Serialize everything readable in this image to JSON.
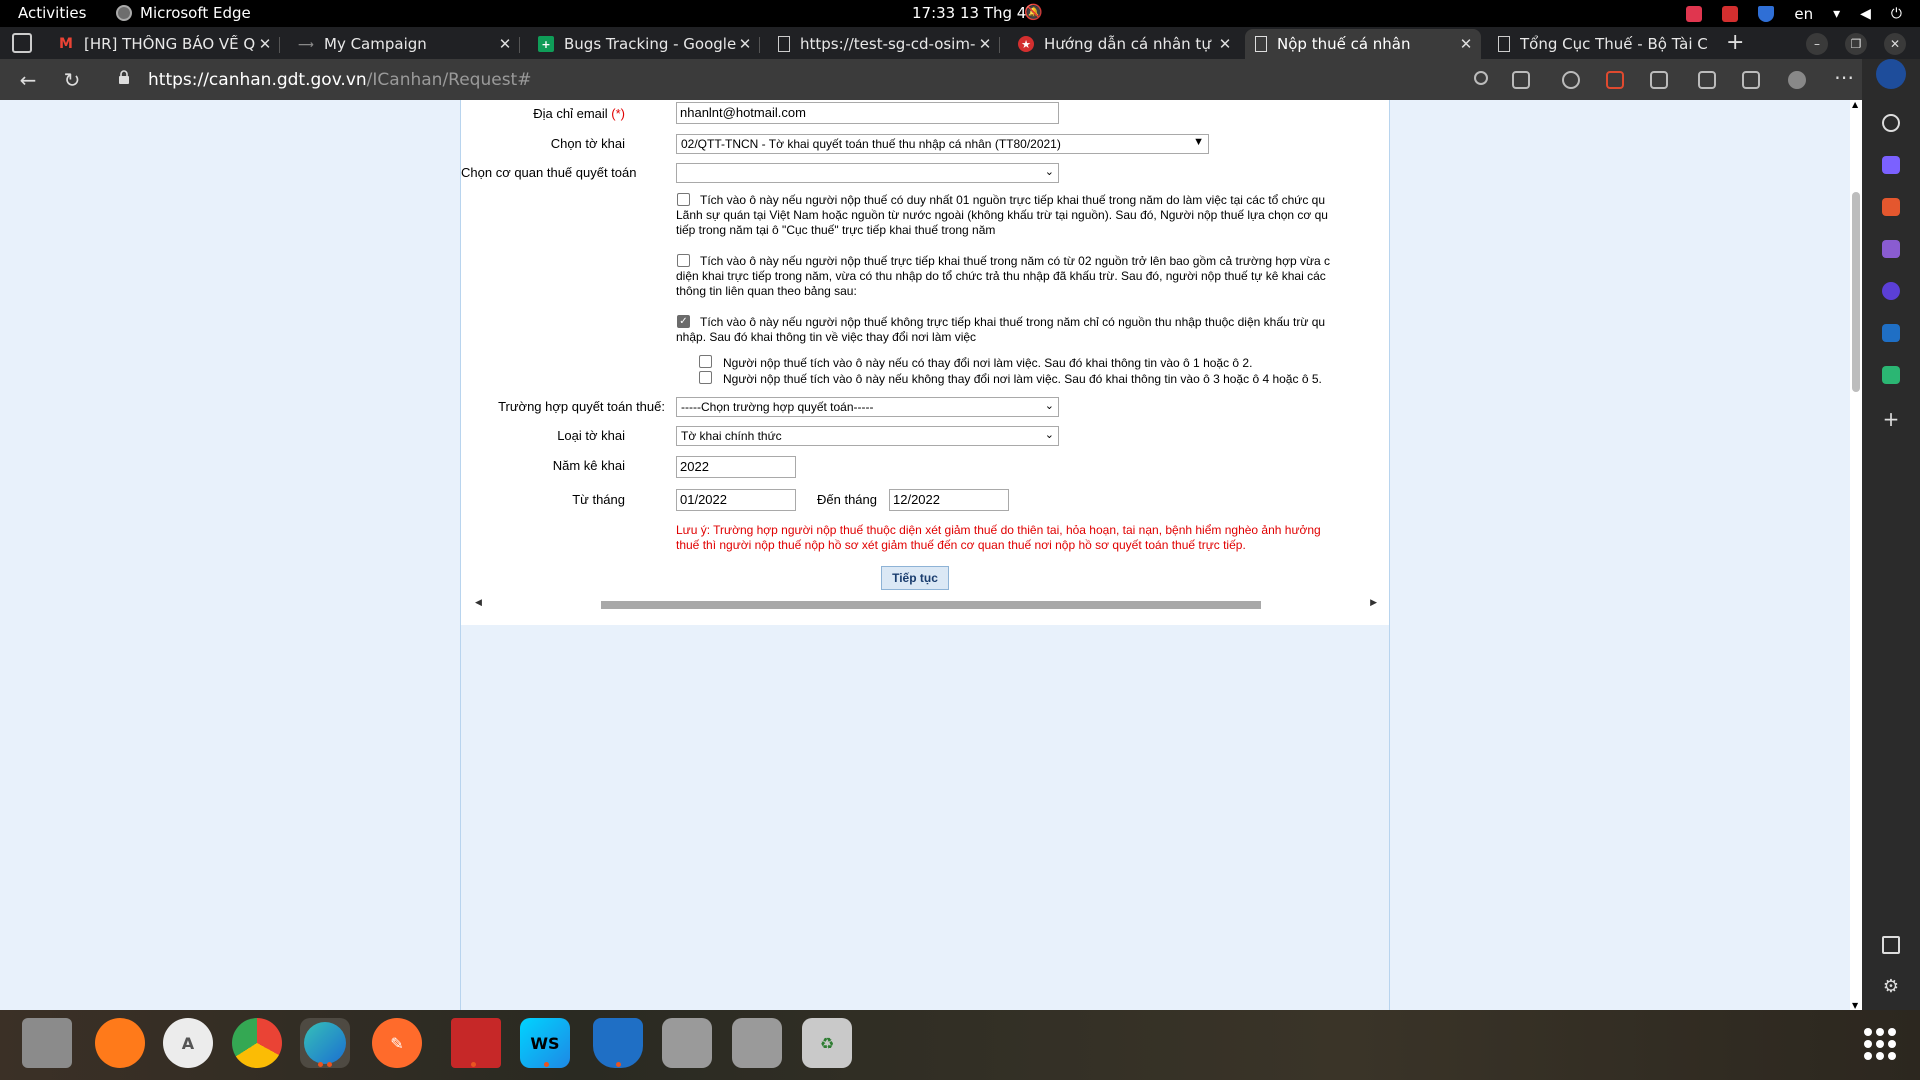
{
  "system_bar": {
    "activities": "Activities",
    "app_name": "Microsoft Edge",
    "clock": "17:33  13 Thg 4",
    "language": "en"
  },
  "tabs": [
    {
      "title": "[HR] THÔNG BÁO VỀ QUY",
      "favicon": "gmail-icon",
      "active": false
    },
    {
      "title": "My Campaign",
      "favicon": "campaign-icon",
      "active": false
    },
    {
      "title": "Bugs Tracking - Google Sh",
      "favicon": "sheets-icon",
      "active": false
    },
    {
      "title": "https://test-sg-cd-osim-n",
      "favicon": "page-icon",
      "active": false
    },
    {
      "title": "Hướng dẫn cá nhân tự q",
      "favicon": "vn-tax-icon",
      "active": false
    },
    {
      "title": "Nộp thuế cá nhân",
      "favicon": "page-icon",
      "active": true
    },
    {
      "title": "Tổng Cục Thuế - Bộ Tài C",
      "favicon": "page-icon",
      "active": false
    }
  ],
  "address_bar": {
    "url_host": "https://canhan.gdt.gov.vn",
    "url_path": "/ICanhan/Request#"
  },
  "form": {
    "email_label": "Địa chỉ email",
    "required_mark": "(*)",
    "email_value": "nhanlnt@hotmail.com",
    "declaration_label": "Chọn tờ khai",
    "declaration_value": "02/QTT-TNCN - Tờ khai quyết toán thuế thu nhập cá nhân (TT80/2021)",
    "tax_office_label": "Chọn cơ quan thuế quyết toán",
    "tax_office_value": "",
    "option1": {
      "checked": false,
      "line1": "Tích vào ô này nếu người nộp thuế có duy nhất 01 nguồn trực tiếp khai thuế trong năm do làm việc tại các tổ chức qu",
      "line2": "Lãnh sự quán tại Việt Nam hoặc nguồn từ nước ngoài (không khấu trừ tại nguồn). Sau đó, Người nộp thuế lựa chọn cơ qu",
      "line3": "tiếp trong năm tại ô \"Cục thuế\" trực tiếp khai thuế trong năm"
    },
    "option2": {
      "checked": false,
      "line1": "Tích vào ô này nếu người nộp thuế trực tiếp khai thuế trong năm có từ 02 nguồn trở lên bao gồm cả trường hợp vừa c",
      "line2": "diện khai trực tiếp trong năm, vừa có thu nhập do tổ chức trả thu nhập đã khấu trừ. Sau đó, người nộp thuế tự kê khai các",
      "line3": "thông tin liên quan theo bảng sau:"
    },
    "option3": {
      "checked": true,
      "line1": "Tích vào ô này nếu người nộp thuế không trực tiếp khai thuế trong năm chỉ có nguồn thu nhập thuộc diện khấu trừ qu",
      "line2": "nhập. Sau đó khai thông tin về việc thay đổi nơi làm việc"
    },
    "sub_option1": {
      "checked": false,
      "text": "Người nộp thuế tích vào ô này nếu có thay đổi nơi làm việc. Sau đó khai thông tin vào ô 1 hoặc ô 2."
    },
    "sub_option2": {
      "checked": false,
      "text": "Người nộp thuế tích vào ô này nếu không thay đổi nơi làm việc. Sau đó khai thông tin vào ô 3 hoặc ô 4 hoặc ô 5."
    },
    "case_label": "Trường hợp quyết toán thuế:",
    "case_value": "-----Chọn trường hợp quyết toán-----",
    "type_label": "Loại tờ khai",
    "type_value": "Tờ khai chính thức",
    "year_label": "Năm kê khai",
    "year_value": "2022",
    "from_label": "Từ tháng",
    "from_value": "01/2022",
    "to_label": "Đến tháng",
    "to_value": "12/2022",
    "note_line1": "Lưu ý: Trường hợp người nộp thuế thuộc diện xét giảm thuế do thiên tai, hỏa hoạn, tai nạn, bệnh hiểm nghèo ảnh hưởng",
    "note_line2": "thuế thì người nộp thuế nộp hồ sơ xét giảm thuế đến cơ quan thuế nơi nộp hồ sơ quyết toán thuế trực tiếp.",
    "continue_button": "Tiếp tục"
  },
  "colors": {
    "required": "#e00000",
    "note": "#e00000",
    "page_background": "#e8f1fb",
    "button_text": "#1a3d6e"
  },
  "dock": [
    {
      "name": "files-app",
      "label": ""
    },
    {
      "name": "firefox-app",
      "label": ""
    },
    {
      "name": "software-center-app",
      "label": ""
    },
    {
      "name": "chrome-app",
      "label": ""
    },
    {
      "name": "edge-app",
      "label": ""
    },
    {
      "name": "pencil-app",
      "label": ""
    },
    {
      "name": "terminal-app",
      "label": ""
    },
    {
      "name": "webstorm-app",
      "label": "WS"
    },
    {
      "name": "shield-app",
      "label": ""
    },
    {
      "name": "disk-app-1",
      "label": ""
    },
    {
      "name": "disk-app-2",
      "label": ""
    },
    {
      "name": "trash-app",
      "label": ""
    }
  ]
}
